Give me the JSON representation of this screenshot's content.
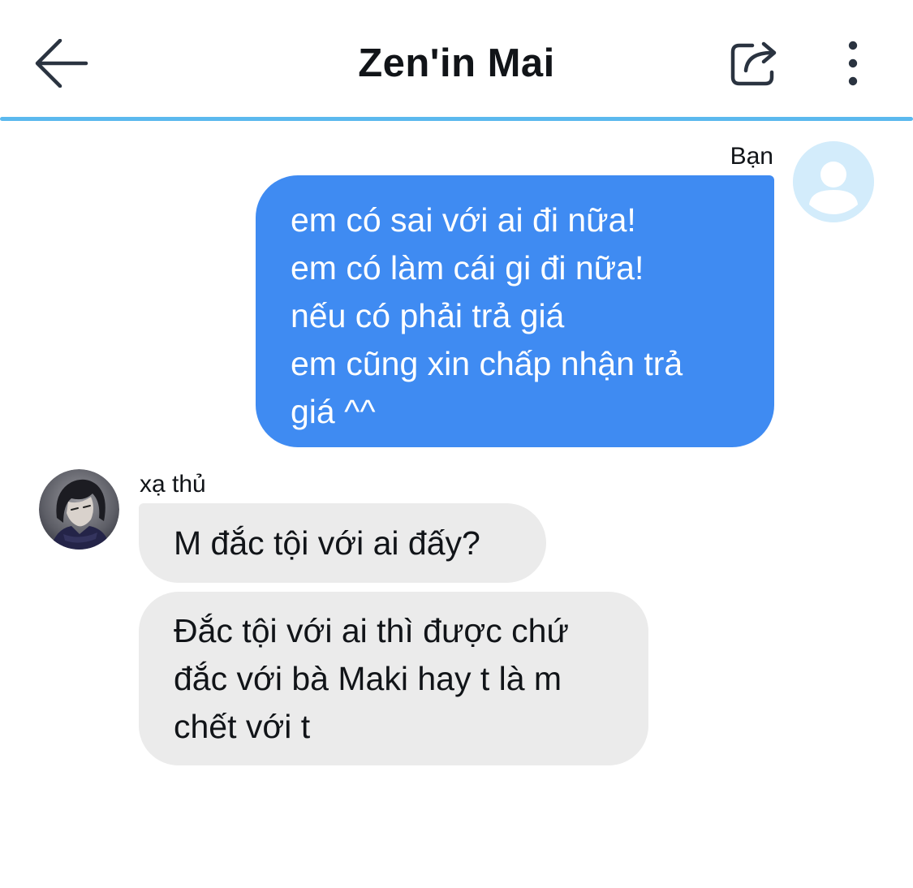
{
  "header": {
    "title": "Zen'in Mai",
    "back_icon": "arrow-left-icon",
    "share_icon": "share-icon",
    "more_icon": "more-vertical-icon",
    "divider_color": "#5bb9ee"
  },
  "messages": [
    {
      "direction": "outgoing",
      "sender": "Bạn",
      "avatar": "default-user-avatar",
      "bubble_color": "#3f8bf2",
      "lines": [
        "em có sai với ai đi nữa!",
        "em có làm cái gi đi nữa!",
        "nếu có phải trả giá",
        "em cũng xin chấp nhận trả",
        "giá ^^"
      ]
    },
    {
      "direction": "incoming",
      "sender": "xạ thủ",
      "avatar": "anime-character-avatar",
      "bubble_color": "#ebebeb",
      "lines": [
        "M đắc tội với ai đấy?"
      ]
    },
    {
      "direction": "incoming",
      "sender": "xạ thủ",
      "bubble_color": "#ebebeb",
      "lines": [
        "Đắc tội với ai thì được chứ",
        "đắc với bà Maki hay t là m",
        "chết với t"
      ]
    }
  ]
}
